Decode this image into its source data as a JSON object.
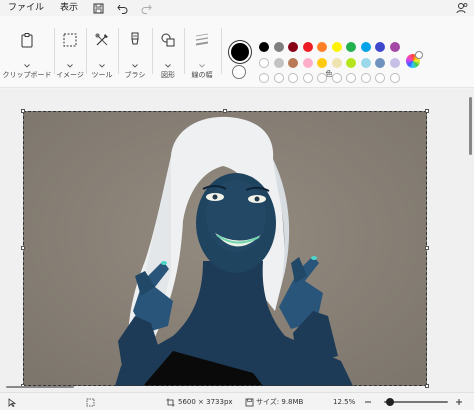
{
  "menubar": {
    "file": "ファイル",
    "view": "表示"
  },
  "ribbon": {
    "clipboard": "クリップボード",
    "image": "イメージ",
    "tools": "ツール",
    "brushes": "ブラシ",
    "shapes": "図形",
    "line_width": "線の幅",
    "colors": "色"
  },
  "palette": {
    "primary_color": "#000000",
    "secondary_color": "#ffffff",
    "row1": [
      "#000000",
      "#7f7f7f",
      "#880015",
      "#ed1c24",
      "#ff7f27",
      "#fff200",
      "#22b14c",
      "#00a2e8",
      "#3f48cc",
      "#a349a4"
    ],
    "row2": [
      "#ffffff",
      "#c3c3c3",
      "#b97a57",
      "#ffaec9",
      "#ffc90e",
      "#efe4b0",
      "#b5e61d",
      "#99d9ea",
      "#7092be",
      "#c8bfe7"
    ],
    "row3_count": 10
  },
  "statusbar": {
    "dimensions": "5600 × 3733px",
    "size": "サイズ: 9.8MB",
    "zoom": "12.5%",
    "zoom_level": 0.1
  }
}
